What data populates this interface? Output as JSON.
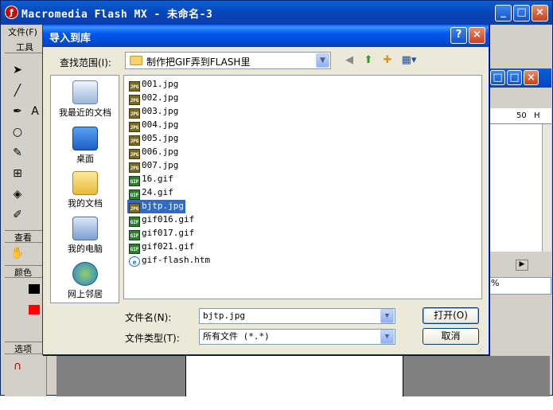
{
  "main_window": {
    "title": "Macromedia Flash MX - 未命名-3",
    "menu": [
      "文件(F)"
    ],
    "toolbox_title": "工具",
    "toolbox_sections": [
      "查看",
      "颜色",
      "选项"
    ]
  },
  "inner_panel": {
    "ruler_tick": "50",
    "ruler_unit": "H",
    "zoom": "%"
  },
  "dialog": {
    "title": "导入到库",
    "help_label": "?",
    "close_label": "×",
    "lookin_label": "查找范围(I):",
    "lookin_value": "制作把GIF弄到FLASH里",
    "places": [
      {
        "label": "我最近的文档",
        "icon": "recent-documents-icon"
      },
      {
        "label": "桌面",
        "icon": "desktop-icon"
      },
      {
        "label": "我的文档",
        "icon": "my-documents-icon"
      },
      {
        "label": "我的电脑",
        "icon": "my-computer-icon"
      },
      {
        "label": "网上邻居",
        "icon": "network-places-icon"
      }
    ],
    "files": [
      {
        "name": "001.jpg",
        "type": "jpg"
      },
      {
        "name": "002.jpg",
        "type": "jpg"
      },
      {
        "name": "003.jpg",
        "type": "jpg"
      },
      {
        "name": "004.jpg",
        "type": "jpg"
      },
      {
        "name": "005.jpg",
        "type": "jpg"
      },
      {
        "name": "006.jpg",
        "type": "jpg"
      },
      {
        "name": "007.jpg",
        "type": "jpg"
      },
      {
        "name": "16.gif",
        "type": "gif"
      },
      {
        "name": "24.gif",
        "type": "gif"
      },
      {
        "name": "bjtp.jpg",
        "type": "jpg",
        "selected": true
      },
      {
        "name": "gif016.gif",
        "type": "gif"
      },
      {
        "name": "gif017.gif",
        "type": "gif"
      },
      {
        "name": "gif021.gif",
        "type": "gif"
      },
      {
        "name": "gif-flash.htm",
        "type": "htm"
      }
    ],
    "filename_label": "文件名(N):",
    "filename_value": "bjtp.jpg",
    "filetype_label": "文件类型(T):",
    "filetype_value": "所有文件 (*.*)",
    "open_button": "打开(O)",
    "cancel_button": "取消"
  }
}
